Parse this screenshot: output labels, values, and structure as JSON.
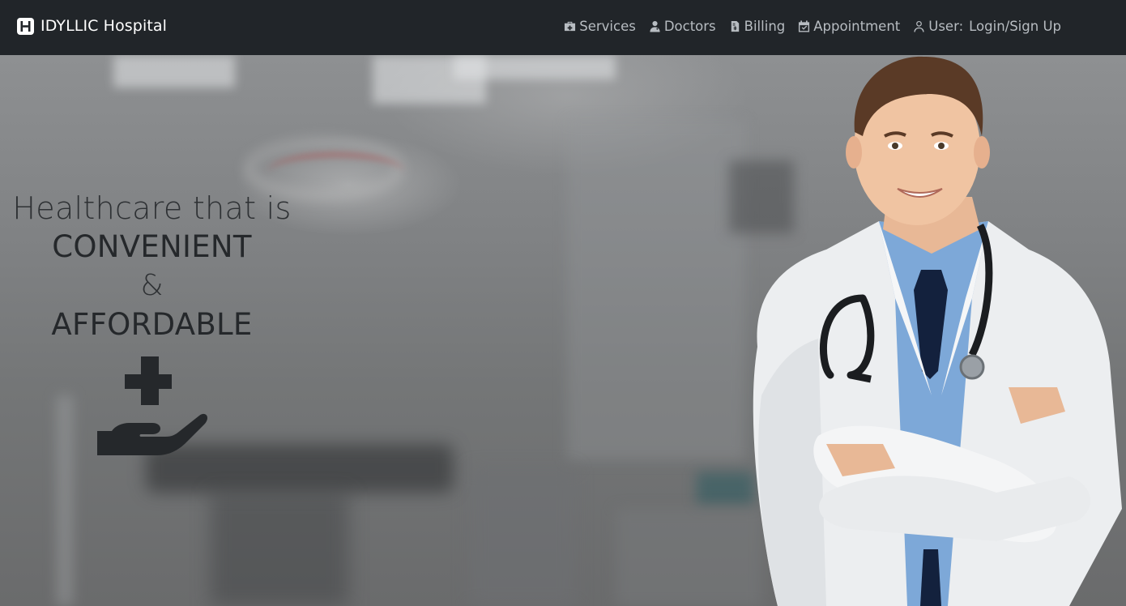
{
  "brand": {
    "name": "IDYLLIC Hospital",
    "icon": "hospital-icon"
  },
  "nav": {
    "items": [
      {
        "label": "Services",
        "icon": "medkit-icon"
      },
      {
        "label": "Doctors",
        "icon": "user-doctor-icon"
      },
      {
        "label": "Billing",
        "icon": "invoice-icon"
      },
      {
        "label": "Appointment",
        "icon": "calendar-check-icon"
      }
    ],
    "user": {
      "label": "User:",
      "link": "Login/Sign Up",
      "icon": "user-icon"
    }
  },
  "hero": {
    "line1": "Healthcare that is",
    "line2": "CONVENIENT",
    "line3": "&",
    "line4": "AFFORDABLE",
    "icon": "hand-holding-medical-icon"
  },
  "colors": {
    "navbar": "#212529",
    "nav_text": "#b7bcc1",
    "hero_text": "#2b2e31"
  }
}
